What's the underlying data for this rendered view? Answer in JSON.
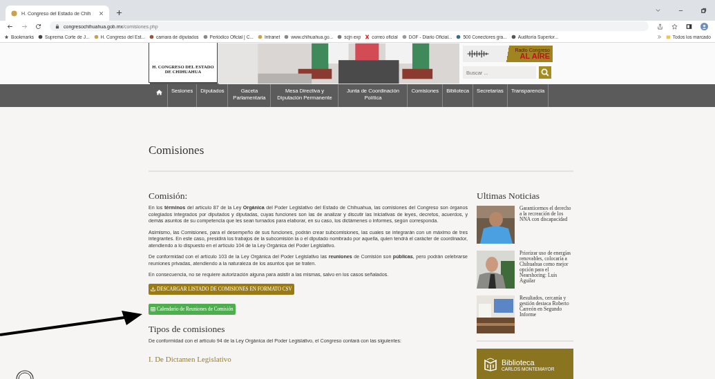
{
  "browser": {
    "tab_title": "H. Congreso del Estado de Chih",
    "url_host": "congresochihuahua.gob.mx",
    "url_path": "/comisiones.php",
    "bookmarks": [
      "Bookmarks",
      "Suprema Corte de J...",
      "H. Congreso del Est...",
      "camara de diputados",
      "Periódico Oficial | C...",
      "Intranet",
      "www.chihuahua.go...",
      "scjn exp",
      "correo oficial",
      "DOF - Diario Oficial...",
      "500 Conectores gra...",
      "Auditoría Superior..."
    ],
    "all_bookmarks": "Todos los marcado"
  },
  "header": {
    "logo_lines": [
      "H. CONGRESO DEL ESTADO",
      "DE CHIHUAHUA"
    ],
    "radio_top": "Radio Congreso",
    "radio_bottom": "AL AIRE",
    "search": {
      "placeholder": "Buscar ..."
    }
  },
  "nav": [
    {
      "kind": "home"
    },
    {
      "kind": "text",
      "label": "Sesiones"
    },
    {
      "kind": "text",
      "label": "Diputados"
    },
    {
      "kind": "text",
      "label": "Gaceta Parlamentaria"
    },
    {
      "kind": "text",
      "label": "Mesa Directiva y Diputación Permanente"
    },
    {
      "kind": "text",
      "label": "Junta de Coordinación Política"
    },
    {
      "kind": "text",
      "label": "Comisiones"
    },
    {
      "kind": "text",
      "label": "Biblioteca"
    },
    {
      "kind": "text",
      "label": "Secretarías"
    },
    {
      "kind": "text",
      "label": "Transparencia"
    }
  ],
  "page_title": "Comisiones",
  "main": {
    "heading": "Comisión:",
    "paragraphs": [
      "En los **términos** del artículo 87 de la Ley **Orgánica** del Poder Legislativo del Estado de Chihuahua, las comisiones del Congreso son órganos colegiados integrados por diputados y diputadas, cuyas funciones son las de analizar y discutir las iniciativas de leyes, decretos, acuerdos, y demás asuntos de su competencia que les sean turnados para elaborar, en su caso, los dictámenes o informes, según corresponda.",
      "Asimismo, las Comisiones, para el desempeño de sus funciones, podrán crear subcomisiones, las cuales se integrarán con un máximo de tres integrantes. En este caso, presidirá los trabajos de la subcomisión la o el diputado nombrado por aquella, quien tendrá el carácter de coordinador, atendiendo a lo dispuesto en el artículo 104 de la Ley Orgánica del Poder Legislativo.",
      "De conformidad con el artículo 103 de la Ley Orgánica del Poder Legislativo las **reuniones** de Comisión son **públicas**, pero podrán celebrarse reuniones privadas, atendiendo a la naturaleza de los asuntos que se traten.",
      "En consecuencia, no se requiere autorización alguna para asistir a las mismas, salvo en los casos señalados."
    ],
    "buttons": [
      {
        "kind": "csv",
        "label": "DESCARGAR LISTADO DE COMISIONES EN FORMATO CSV"
      },
      {
        "kind": "calendar",
        "label": "Calendario de Reuniones de Comisión"
      }
    ],
    "types_heading": "Tipos de comisiones",
    "types_intro": "De conformidad con el artículo 94 de la Ley Orgánica del Poder Legislativo, el Congreso contará con las siguientes:",
    "first_type": "I. De Dictamen Legislativo"
  },
  "sidebar": {
    "heading": "Ultimas Noticias",
    "news": [
      {
        "title": "Garanticemos el derecho a la recreación de los NNA con discapacidad",
        "kind": "picture"
      },
      {
        "title": "Priorizar uso de energías renovables, colocaría a Chihuahua como mejor opción para el Nearshoring: Luis Aguilar",
        "kind": "picture"
      },
      {
        "title": "Resultados, cercanía y gestión destaca Roberto Carreón en Segundo Informe",
        "kind": "picture"
      }
    ],
    "banner": {
      "title": "Biblioteca",
      "subtitle": "CARLOS MONTEMAYOR"
    }
  }
}
